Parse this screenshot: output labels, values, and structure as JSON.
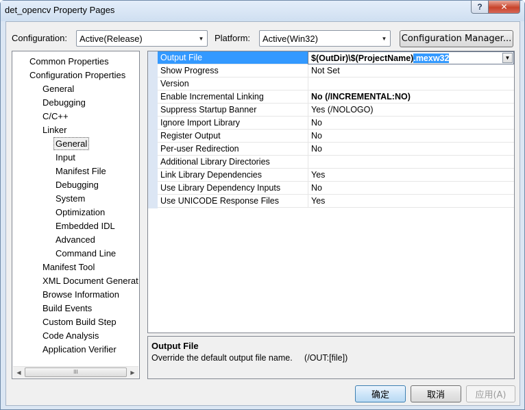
{
  "window": {
    "title": "det_opencv Property Pages",
    "help_label": "?",
    "close_label": "✕"
  },
  "configuration": {
    "label": "Configuration:",
    "value": "Active(Release)"
  },
  "platform": {
    "label": "Platform:",
    "value": "Active(Win32)"
  },
  "config_manager_label": "Configuration Manager...",
  "tree": [
    {
      "label": "Common Properties",
      "level": 0
    },
    {
      "label": "Configuration Properties",
      "level": 0
    },
    {
      "label": "General",
      "level": 1
    },
    {
      "label": "Debugging",
      "level": 1
    },
    {
      "label": "C/C++",
      "level": 1
    },
    {
      "label": "Linker",
      "level": 1
    },
    {
      "label": "General",
      "level": 2,
      "selected": true
    },
    {
      "label": "Input",
      "level": 2
    },
    {
      "label": "Manifest File",
      "level": 2
    },
    {
      "label": "Debugging",
      "level": 2
    },
    {
      "label": "System",
      "level": 2
    },
    {
      "label": "Optimization",
      "level": 2
    },
    {
      "label": "Embedded IDL",
      "level": 2
    },
    {
      "label": "Advanced",
      "level": 2
    },
    {
      "label": "Command Line",
      "level": 2
    },
    {
      "label": "Manifest Tool",
      "level": 1
    },
    {
      "label": "XML Document Generat",
      "level": 1
    },
    {
      "label": "Browse Information",
      "level": 1
    },
    {
      "label": "Build Events",
      "level": 1
    },
    {
      "label": "Custom Build Step",
      "level": 1
    },
    {
      "label": "Code Analysis",
      "level": 1
    },
    {
      "label": "Application Verifier",
      "level": 1
    }
  ],
  "properties": [
    {
      "name": "Output File",
      "value": "$(OutDir)\\$(ProjectName)",
      "value_highlight": ".mexw32",
      "bold": true,
      "selected": true
    },
    {
      "name": "Show Progress",
      "value": "Not Set"
    },
    {
      "name": "Version",
      "value": ""
    },
    {
      "name": "Enable Incremental Linking",
      "value": "No (/INCREMENTAL:NO)",
      "bold": true
    },
    {
      "name": "Suppress Startup Banner",
      "value": "Yes (/NOLOGO)"
    },
    {
      "name": "Ignore Import Library",
      "value": "No"
    },
    {
      "name": "Register Output",
      "value": "No"
    },
    {
      "name": "Per-user Redirection",
      "value": "No"
    },
    {
      "name": "Additional Library Directories",
      "value": ""
    },
    {
      "name": "Link Library Dependencies",
      "value": "Yes"
    },
    {
      "name": "Use Library Dependency Inputs",
      "value": "No"
    },
    {
      "name": "Use UNICODE Response Files",
      "value": "Yes"
    }
  ],
  "description": {
    "title": "Output File",
    "text": "Override the default output file name.     (/OUT:[file])"
  },
  "buttons": {
    "ok": "确定",
    "cancel": "取消",
    "apply": "应用(A)"
  },
  "scroll_thumb_glyph": "III"
}
